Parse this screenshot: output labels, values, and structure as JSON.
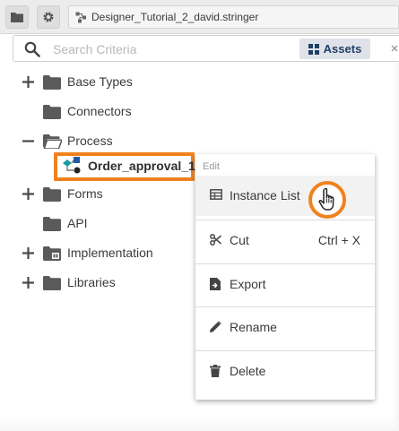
{
  "toolbar": {
    "breadcrumb": "Designer_Tutorial_2_david.stringer"
  },
  "search": {
    "placeholder": "Search Criteria",
    "value": "",
    "assets_label": "Assets"
  },
  "tree": {
    "items": [
      {
        "label": "Base Types",
        "toggle": "plus"
      },
      {
        "label": "Connectors",
        "toggle": "none"
      },
      {
        "label": "Process",
        "toggle": "minus"
      },
      {
        "label": "Order_approval_1",
        "toggle": "none",
        "selected": true
      },
      {
        "label": "Forms",
        "toggle": "plus"
      },
      {
        "label": "API",
        "toggle": "none"
      },
      {
        "label": "Implementation",
        "toggle": "plus"
      },
      {
        "label": "Libraries",
        "toggle": "plus"
      }
    ]
  },
  "context_menu": {
    "header": "Edit",
    "items": [
      {
        "label": "Instance List",
        "icon": "table-icon"
      },
      {
        "label": "Cut",
        "shortcut": "Ctrl + X",
        "icon": "scissors-icon"
      },
      {
        "label": "Export",
        "icon": "export-icon"
      },
      {
        "label": "Rename",
        "icon": "pencil-icon"
      },
      {
        "label": "Delete",
        "icon": "trash-icon"
      }
    ]
  },
  "colors": {
    "highlight": "#f0821e",
    "assets_text": "#1f3f66",
    "folder": "#5a5a5a"
  }
}
